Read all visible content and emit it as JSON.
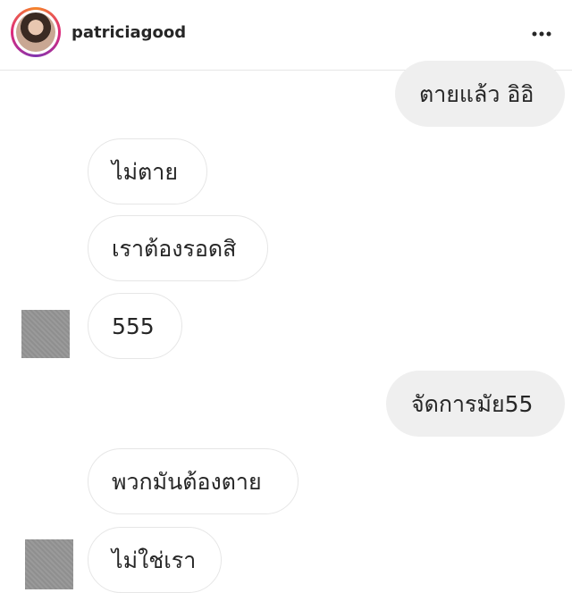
{
  "header": {
    "username": "patriciagood",
    "more_icon": "more-horizontal-icon"
  },
  "messages": [
    {
      "sender": "me",
      "text": "ตายแล้ว อิอิ"
    },
    {
      "sender": "them",
      "text": "ไม่ตาย"
    },
    {
      "sender": "them",
      "text": "เราต้องรอดสิ"
    },
    {
      "sender": "them",
      "text": "555"
    },
    {
      "sender": "me",
      "text": "จัดการมัย55"
    },
    {
      "sender": "them",
      "text": "พวกมันต้องตาย"
    },
    {
      "sender": "them",
      "text": "ไม่ใช่เรา"
    }
  ]
}
